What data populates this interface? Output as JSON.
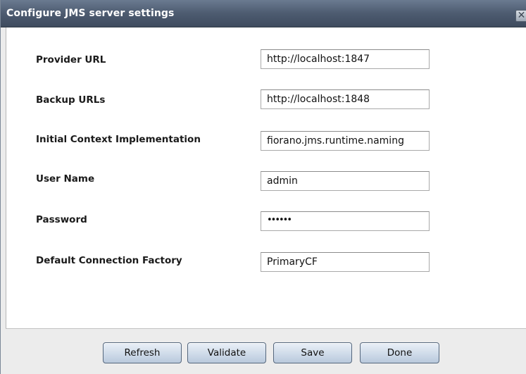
{
  "window": {
    "title": "Configure JMS server settings",
    "close_icon": "close-icon"
  },
  "form": {
    "provider_url": {
      "label": "Provider URL",
      "value": "http://localhost:1847"
    },
    "backup_urls": {
      "label": "Backup URLs",
      "value": "http://localhost:1848"
    },
    "initial_context": {
      "label": "Initial Context Implementation",
      "value": "fiorano.jms.runtime.naming"
    },
    "user_name": {
      "label": "User Name",
      "value": "admin"
    },
    "password": {
      "label": "Password",
      "value": "••••••"
    },
    "default_cf": {
      "label": "Default Connection Factory",
      "value": "PrimaryCF"
    }
  },
  "buttons": {
    "refresh": "Refresh",
    "validate": "Validate",
    "save": "Save",
    "done": "Done"
  }
}
